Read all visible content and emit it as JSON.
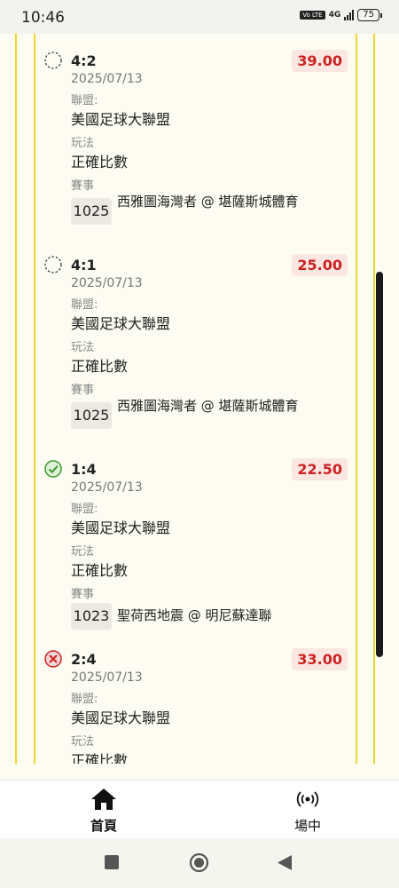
{
  "status_bar": {
    "time": "10:46",
    "volte": "Vo LTE",
    "network": "4G",
    "battery": "75"
  },
  "bets": [
    {
      "status": "pending",
      "score": "4:2",
      "date": "2025/07/13",
      "odds": "39.00",
      "league_label": "聯盟:",
      "league": "美國足球大聯盟",
      "play_label": "玩法",
      "play": "正確比數",
      "match_label": "賽事",
      "match_id": "1025",
      "match_name": "西雅圖海灣者 @ 堪薩斯城體育"
    },
    {
      "status": "pending",
      "score": "4:1",
      "date": "2025/07/13",
      "odds": "25.00",
      "league_label": "聯盟:",
      "league": "美國足球大聯盟",
      "play_label": "玩法",
      "play": "正確比數",
      "match_label": "賽事",
      "match_id": "1025",
      "match_name": "西雅圖海灣者 @ 堪薩斯城體育"
    },
    {
      "status": "won",
      "score": "1:4",
      "date": "2025/07/13",
      "odds": "22.50",
      "league_label": "聯盟:",
      "league": "美國足球大聯盟",
      "play_label": "玩法",
      "play": "正確比數",
      "match_label": "賽事",
      "match_id": "1023",
      "match_name": "聖荷西地震 @ 明尼蘇達聯"
    },
    {
      "status": "lost",
      "score": "2:4",
      "date": "2025/07/13",
      "odds": "33.00",
      "league_label": "聯盟:",
      "league": "美國足球大聯盟",
      "play_label": "玩法",
      "play": "正確比數"
    }
  ],
  "bottom_nav": {
    "home": {
      "label": "首頁",
      "icon": "home-icon"
    },
    "live": {
      "label": "場中",
      "icon": "broadcast-icon"
    }
  },
  "colors": {
    "accent_rail": "#f0d430",
    "odds_text": "#cc2222",
    "odds_bg": "#fae7e2",
    "won": "#3a9a2a",
    "lost": "#d02020"
  }
}
